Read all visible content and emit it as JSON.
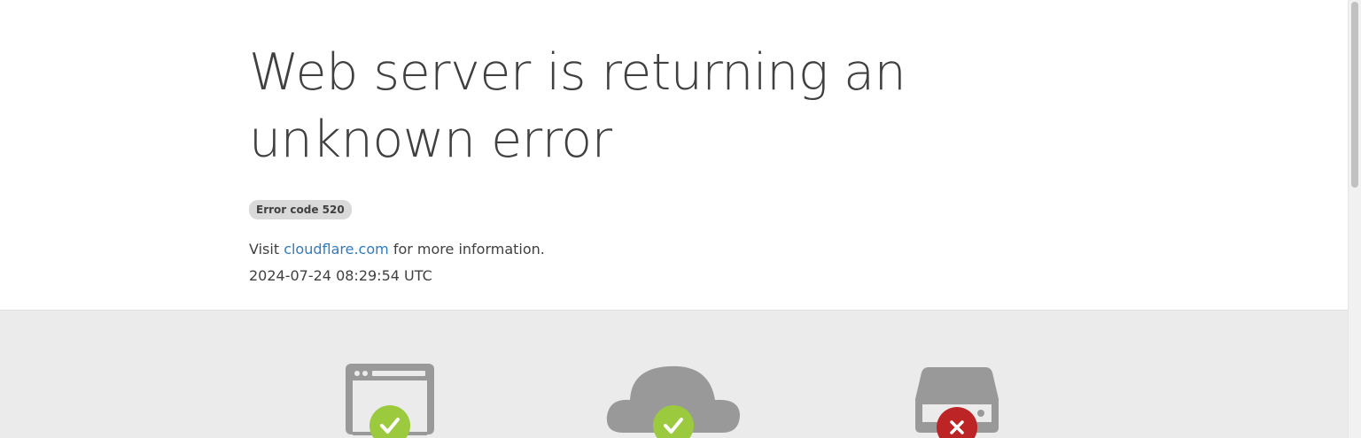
{
  "page": {
    "title": "Web server is returning an unknown error",
    "error_badge": "Error code 520",
    "info_prefix": "Visit ",
    "info_link": "cloudflare.com",
    "info_suffix": " for more information.",
    "timestamp": "2024-07-24 08:29:54 UTC"
  },
  "diagram": {
    "nodes": [
      {
        "icon": "browser-icon",
        "status": "ok",
        "status_icon": "checkmark-icon"
      },
      {
        "icon": "cloud-icon",
        "status": "ok",
        "status_icon": "checkmark-icon"
      },
      {
        "icon": "server-icon",
        "status": "error",
        "status_icon": "x-icon"
      }
    ]
  },
  "colors": {
    "ok": "#9bca3e",
    "error": "#bd2426",
    "icon_gray": "#999999",
    "link": "#2f7bbf"
  }
}
